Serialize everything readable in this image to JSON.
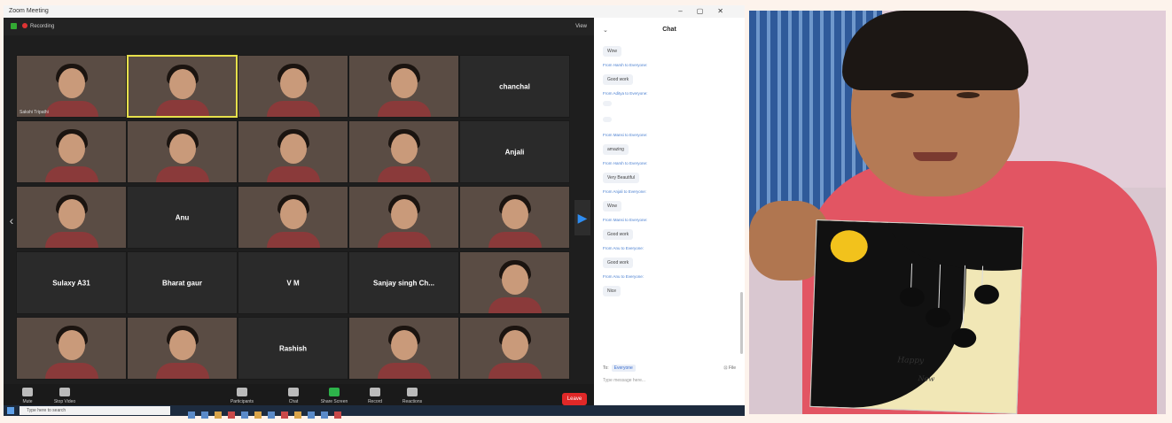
{
  "window": {
    "title": "Zoom Meeting"
  },
  "topbar": {
    "recording": "Recording",
    "view": "View"
  },
  "tiles": [
    {
      "type": "video",
      "caption": "Sakshi Tripathi"
    },
    {
      "type": "video",
      "caption": "",
      "active": true
    },
    {
      "type": "video",
      "caption": ""
    },
    {
      "type": "video",
      "caption": ""
    },
    {
      "type": "name",
      "name": "chanchal",
      "caption": ""
    },
    {
      "type": "video",
      "caption": ""
    },
    {
      "type": "video",
      "caption": ""
    },
    {
      "type": "video",
      "caption": ""
    },
    {
      "type": "video",
      "caption": ""
    },
    {
      "type": "name",
      "name": "Anjali",
      "caption": ""
    },
    {
      "type": "video",
      "caption": ""
    },
    {
      "type": "name",
      "name": "Anu",
      "caption": ""
    },
    {
      "type": "video",
      "caption": ""
    },
    {
      "type": "video",
      "caption": ""
    },
    {
      "type": "video",
      "caption": ""
    },
    {
      "type": "name",
      "name": "Sulaxy A31",
      "caption": ""
    },
    {
      "type": "name",
      "name": "Bharat gaur",
      "caption": ""
    },
    {
      "type": "name",
      "name": "V M",
      "caption": ""
    },
    {
      "type": "name",
      "name": "Sanjay singh Ch...",
      "caption": ""
    },
    {
      "type": "video",
      "caption": ""
    },
    {
      "type": "video",
      "caption": ""
    },
    {
      "type": "video",
      "caption": ""
    },
    {
      "type": "name",
      "name": "Rashish",
      "caption": ""
    },
    {
      "type": "video",
      "caption": ""
    },
    {
      "type": "video",
      "caption": ""
    }
  ],
  "toolbar": {
    "buttons": [
      {
        "label": "Mute"
      },
      {
        "label": "Stop Video"
      },
      {
        "label": "Participants"
      },
      {
        "label": "Chat"
      },
      {
        "label": "Share Screen"
      },
      {
        "label": "Record"
      },
      {
        "label": "Reactions"
      }
    ],
    "end": "Leave"
  },
  "chat": {
    "title": "Chat",
    "messages": [
      {
        "from": "",
        "text": "Wow"
      },
      {
        "from": "From Harsh to Everyone:",
        "text": "Good work"
      },
      {
        "from": "From Aditya to Everyone:",
        "text": ""
      },
      {
        "from": "",
        "text": ""
      },
      {
        "from": "From Mansi to Everyone:",
        "text": "amazing"
      },
      {
        "from": "From Harsh to Everyone:",
        "text": "Very Beautiful"
      },
      {
        "from": "From Anjali to Everyone:",
        "text": "Wow"
      },
      {
        "from": "From Mansi to Everyone:",
        "text": "Good work"
      },
      {
        "from": "From Anu to Everyone:",
        "text": "Good work"
      },
      {
        "from": "From Anu to Everyone:",
        "text": "Nice"
      }
    ],
    "to_label": "To:",
    "to_value": "Everyone",
    "file_label": "File",
    "placeholder": "Type message here..."
  },
  "taskbar": {
    "search_placeholder": "Type here to search",
    "time": "",
    "date": ""
  },
  "card": {
    "line1": "Happy",
    "line2": "New"
  }
}
